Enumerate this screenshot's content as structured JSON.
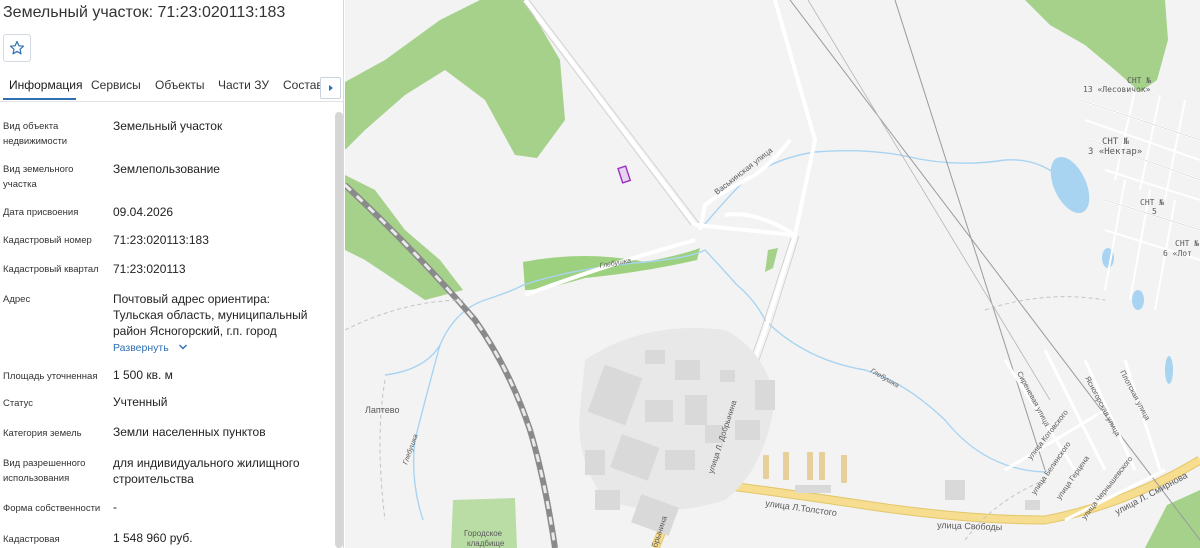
{
  "header": {
    "title": "Земельный участок: 71:23:020113:183"
  },
  "tabs": [
    "Информация",
    "Сервисы",
    "Объекты",
    "Части ЗУ",
    "Состав"
  ],
  "fields": [
    {
      "label": "Вид объекта недвижимости",
      "value": "Земельный участок"
    },
    {
      "label": "Вид земельного участка",
      "value": "Землепользование"
    },
    {
      "label": "Дата присвоения",
      "value": "09.04.2026"
    },
    {
      "label": "Кадастровый номер",
      "value": "71:23:020113:183"
    },
    {
      "label": "Кадастровый квартал",
      "value": "71:23:020113"
    },
    {
      "label": "Адрес",
      "value": "Почтовый адрес ориентира: Тульская область, муниципальный район Ясногорский, г.п. город"
    },
    {
      "label": "Площадь уточненная",
      "value": "1 500 кв. м"
    },
    {
      "label": "Статус",
      "value": "Учтенный"
    },
    {
      "label": "Категория земель",
      "value": "Земли населенных пунктов"
    },
    {
      "label": "Вид разрешенного использования",
      "value": "для индивидуального жилищного строительства"
    },
    {
      "label": "Форма собственности",
      "value": "-"
    },
    {
      "label": "Кадастровая",
      "value": "1 548 960 руб."
    }
  ],
  "expand_label": "Развернуть",
  "map": {
    "labels": {
      "snt_lesovichok": "СНТ №",
      "snt_lesovichok_num": "13 «Лесовичок»",
      "snt_nektar": "СНТ №",
      "snt_nektar_num": "3 «Нектар»",
      "snt_5": "СНТ №",
      "snt_5_num": "5",
      "snt_lot": "СНТ №",
      "snt_lot_num": "6 «Лот",
      "vaskinskaya": "Васькинская улица",
      "glebushka1": "Глебушка",
      "glebushka2": "Глебушка",
      "glebushka3": "Глебушка",
      "laptevo": "Лаптево",
      "dobrynina": "улица Л. Добрынина",
      "dobrynina2": "брынина",
      "tolstogo": "улица Л.Толстого",
      "svobody": "улица Свободы",
      "smirnova": "улица Л. Смирнова",
      "sirenevaya": "Сиреневая улица",
      "kotovskogo": "улица Котовского",
      "yasnogorskaya": "Ясногорская улица",
      "plotskaya": "Плотская улица",
      "belinskogo": "улица Белинского",
      "gertsena": "улица Герцена",
      "chernyshevskogo": "улица Чернышевского",
      "cemetery1": "Городское",
      "cemetery2": "кладбище"
    },
    "colors": {
      "forest": "#a5d18a",
      "water": "#a8d4f2",
      "road": "#ffffff",
      "main_road": "#f6dd8f",
      "building": "#d9d9d9",
      "parcel": "#9b2fbf",
      "railway": "#8a8a8a"
    }
  }
}
